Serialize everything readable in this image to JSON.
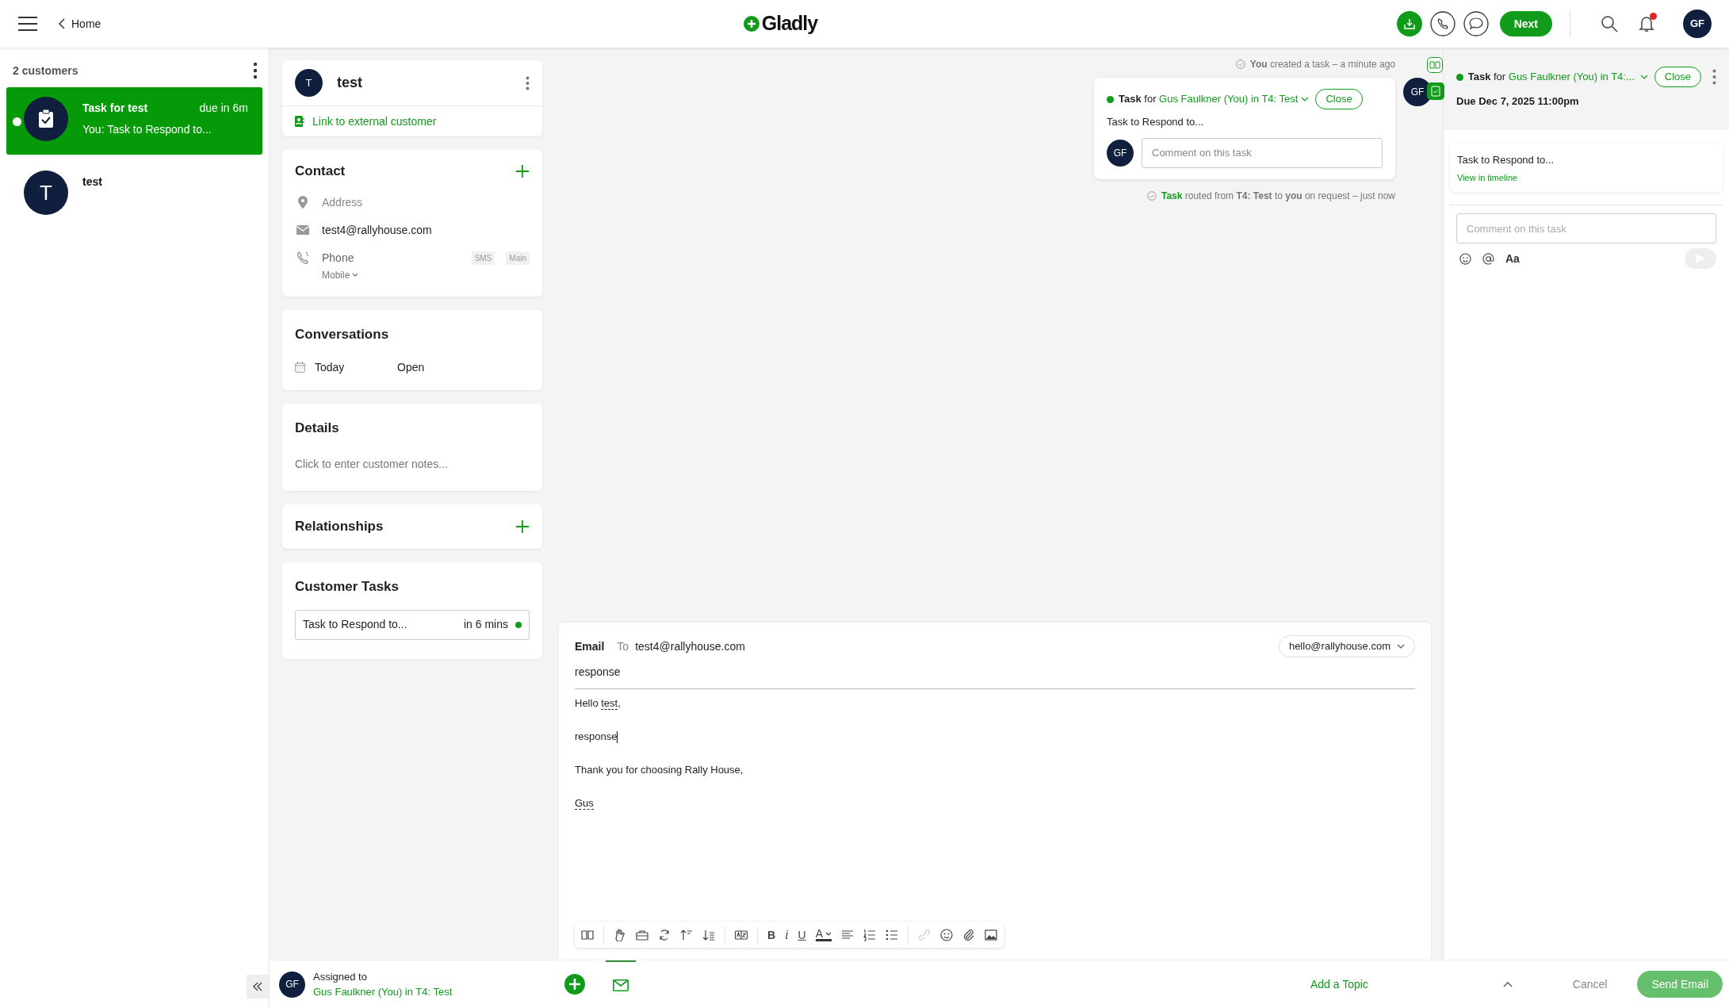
{
  "top_bar": {
    "back_link": "Home",
    "logo": "Gladly",
    "next_button": "Next",
    "notifications_unread": true,
    "avatar": "GF"
  },
  "customer_list": {
    "count": "2 customers",
    "items": [
      {
        "kind": "task",
        "title": "Task for test",
        "due": "due in 6m",
        "preview": "You: Task to Respond to...",
        "selected": true,
        "unread": true
      },
      {
        "kind": "customer",
        "initial": "T",
        "title": "test",
        "selected": false,
        "unread": false
      }
    ]
  },
  "profile": {
    "initial": "T",
    "name": "test",
    "link": "Link to external customer"
  },
  "contact": {
    "title": "Contact",
    "address_placeholder": "Address",
    "email": "test4@rallyhouse.com",
    "phone_placeholder": "Phone",
    "phone_tags": [
      "SMS",
      "Main"
    ],
    "phone_type": "Mobile"
  },
  "conversations": {
    "title": "Conversations",
    "items": [
      {
        "date": "Today",
        "status": "Open"
      }
    ]
  },
  "details": {
    "title": "Details",
    "placeholder": "Click to enter customer notes..."
  },
  "relationships": {
    "title": "Relationships"
  },
  "customer_tasks": {
    "title": "Customer Tasks",
    "items": [
      {
        "text": "Task to Respond to...",
        "due": "in 6 mins"
      }
    ]
  },
  "timeline": {
    "created_event": "**You** created a task – a minute ago",
    "task_card": {
      "label": "Task",
      "connector": "for",
      "assignee": "Gus Faulkner (You) in T4: Test",
      "close": "Close",
      "text": "Task to Respond to...",
      "avatar": "GF",
      "comment_placeholder": "Comment on this task"
    },
    "author_avatar": "GF",
    "routed_event": {
      "task_link": "Task",
      "text": "routed from **T4: Test** to **you** on request – just now"
    }
  },
  "composer": {
    "channel": "Email",
    "to_label": "To",
    "to": "test4@rallyhouse.com",
    "from": "hello@rallyhouse.com",
    "subject": "response",
    "body": [
      [
        {
          "text": "Hello "
        },
        {
          "text": "test",
          "variable": true
        },
        {
          "text": ","
        }
      ],
      [
        {
          "text": "response"
        }
      ],
      [
        {
          "text": "Thank you for choosing Rally House,"
        }
      ],
      [
        {
          "text": "Gus",
          "variable": true
        }
      ]
    ],
    "text_format": [
      {
        "kind": "bold",
        "glyph": "B"
      },
      {
        "kind": "italic",
        "glyph": "i"
      },
      {
        "kind": "underline",
        "glyph": "U"
      },
      {
        "kind": "color",
        "glyph": "A"
      }
    ]
  },
  "task_panel": {
    "label": "Task",
    "connector": "for",
    "assignee": "Gus Faulkner (You) in T4:...",
    "close": "Close",
    "due": "Due Dec 7, 2025 11:00pm",
    "text": "Task to Respond to...",
    "view_link": "View in timeline",
    "comment_placeholder": "Comment on this task",
    "format_glyph": "Aa"
  },
  "bottom_bar": {
    "avatar": "GF",
    "assigned_label": "Assigned to",
    "assignee": "Gus Faulkner (You) in T4: Test",
    "add_topic": "Add a Topic",
    "cancel": "Cancel",
    "send": "Send Email"
  }
}
